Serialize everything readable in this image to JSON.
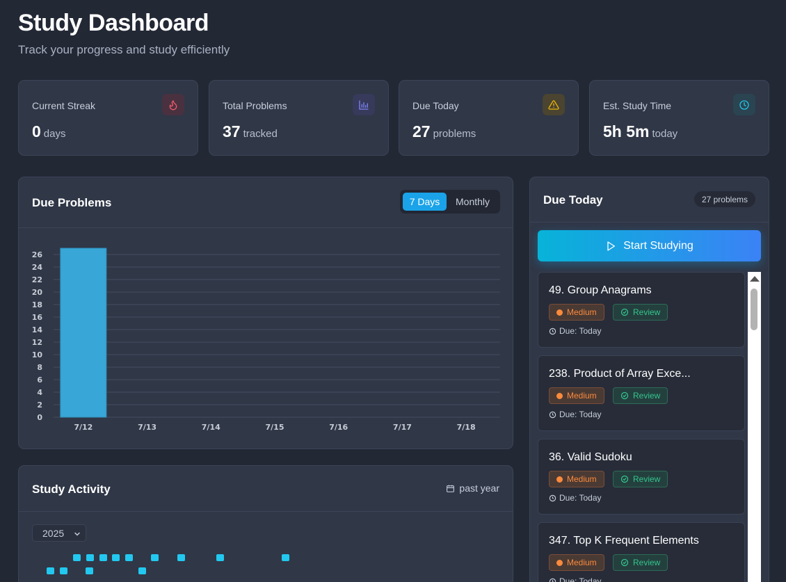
{
  "header": {
    "title": "Study Dashboard",
    "subtitle": "Track your progress and study efficiently"
  },
  "stats": [
    {
      "label": "Current Streak",
      "value": "0",
      "unit": "days",
      "icon": "flame-icon",
      "color": "#f05a6a"
    },
    {
      "label": "Total Problems",
      "value": "37",
      "unit": "tracked",
      "icon": "bar-chart-icon",
      "color": "#7c83f5"
    },
    {
      "label": "Due Today",
      "value": "27",
      "unit": "problems",
      "icon": "warning-icon",
      "color": "#eab308"
    },
    {
      "label": "Est. Study Time",
      "value": "5h 5m",
      "unit": "today",
      "icon": "clock-icon",
      "color": "#22c3e6"
    }
  ],
  "due_problems": {
    "title": "Due Problems",
    "toggle": {
      "active": "7 Days",
      "inactive": "Monthly"
    }
  },
  "chart_data": {
    "type": "bar",
    "categories": [
      "7/12",
      "7/13",
      "7/14",
      "7/15",
      "7/16",
      "7/17",
      "7/18"
    ],
    "values": [
      27,
      0,
      0,
      0,
      0,
      0,
      0
    ],
    "ylim": [
      0,
      27
    ],
    "yticks": [
      0,
      2,
      4,
      6,
      8,
      10,
      12,
      14,
      16,
      18,
      20,
      22,
      24,
      26
    ],
    "grid": true,
    "bar_color": "#38a6d6"
  },
  "study_activity": {
    "title": "Study Activity",
    "range_label": "past year",
    "year": "2025"
  },
  "due_today": {
    "title": "Due Today",
    "badge": "27 problems",
    "start_label": "Start Studying",
    "problems": [
      {
        "title": "49. Group Anagrams",
        "difficulty": "Medium",
        "status": "Review",
        "due": "Due: Today"
      },
      {
        "title": "238. Product of Array Exce...",
        "difficulty": "Medium",
        "status": "Review",
        "due": "Due: Today"
      },
      {
        "title": "36. Valid Sudoku",
        "difficulty": "Medium",
        "status": "Review",
        "due": "Due: Today"
      },
      {
        "title": "347. Top K Frequent Elements",
        "difficulty": "Medium",
        "status": "Review",
        "due": "Due: Today"
      }
    ]
  }
}
